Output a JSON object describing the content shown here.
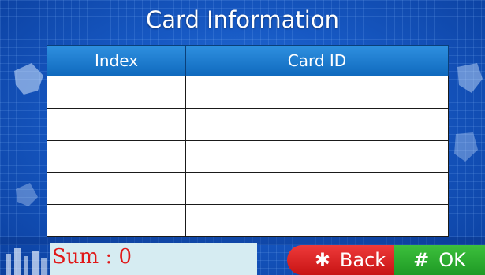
{
  "title": "Card Information",
  "table": {
    "headers": [
      "Index",
      "Card ID"
    ],
    "rows": [
      [
        "",
        ""
      ],
      [
        "",
        ""
      ],
      [
        "",
        ""
      ],
      [
        "",
        ""
      ],
      [
        "",
        ""
      ]
    ]
  },
  "footer": {
    "sum_label": "Sum : 0",
    "back_label": "Back",
    "back_icon": "asterisk-icon",
    "ok_label": "OK",
    "ok_icon": "hash-icon"
  },
  "colors": {
    "background": "#1759c4",
    "header": "#1a78cc",
    "sum_text": "#e01818",
    "back_button": "#dc2626",
    "ok_button": "#2aa52f"
  }
}
